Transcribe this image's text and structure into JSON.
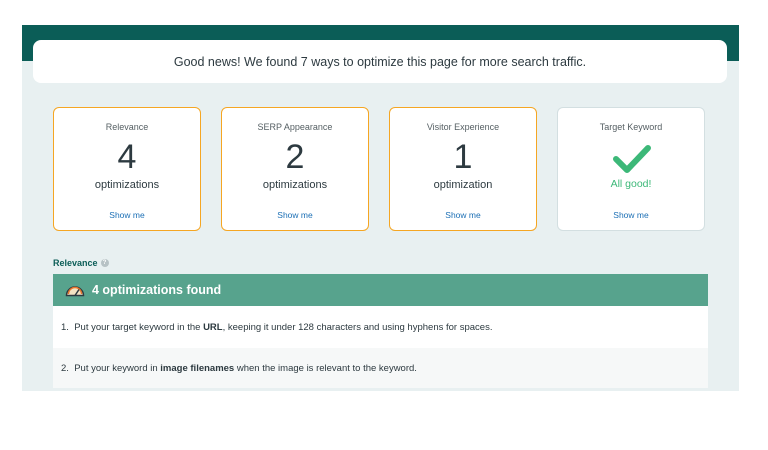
{
  "banner": {
    "text": "Good news! We found 7 ways to optimize this page for more search traffic."
  },
  "cards": [
    {
      "title": "Relevance",
      "count": "4",
      "unit": "optimizations",
      "link": "Show me"
    },
    {
      "title": "SERP Appearance",
      "count": "2",
      "unit": "optimizations",
      "link": "Show me"
    },
    {
      "title": "Visitor Experience",
      "count": "1",
      "unit": "optimization",
      "link": "Show me"
    },
    {
      "title": "Target Keyword",
      "status": "All good!",
      "link": "Show me"
    }
  ],
  "section": {
    "label": "Relevance",
    "help_icon": "?"
  },
  "found_bar": {
    "text": "4 optimizations found"
  },
  "items": [
    {
      "num": "1.",
      "before": "Put your target keyword in the ",
      "bold": "URL",
      "after": ", keeping it under 128 characters and using hyphens for spaces."
    },
    {
      "num": "2.",
      "before": "Put your keyword in ",
      "bold": "image filenames",
      "after": " when the image is relevant to the keyword."
    }
  ],
  "colors": {
    "header": "#0b5d57",
    "accent_border": "#f5a623",
    "found_bar": "#57a38d",
    "success": "#3cb878",
    "link": "#1b6fb5"
  }
}
